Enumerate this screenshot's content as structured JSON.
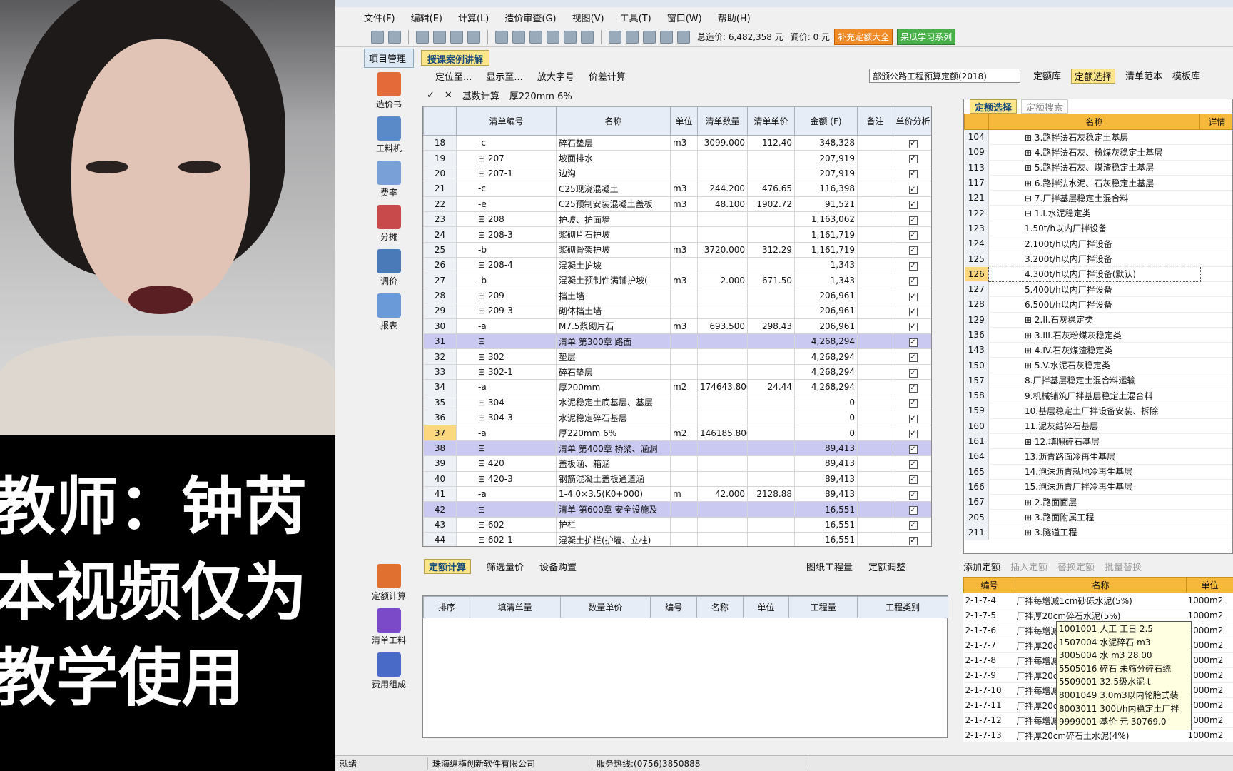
{
  "caption": [
    "教师：钟芮",
    "本视频仅为",
    "教学使用"
  ],
  "menu": [
    "文件(F)",
    "编辑(E)",
    "计算(L)",
    "造价审查(G)",
    "视图(V)",
    "工具(T)",
    "窗口(W)",
    "帮助(H)"
  ],
  "toolbar": {
    "total": "总造价: 6,482,358 元",
    "adjust": "调价: 0 元",
    "btn1": "补充定额大全",
    "btn2": "呆瓜学习系列"
  },
  "leftnav": {
    "tab": "项目管理",
    "items": [
      "造价书",
      "工料机",
      "费率",
      "分摊",
      "调价",
      "报表"
    ],
    "bottom": [
      "定额计算",
      "清单工料",
      "费用组成"
    ]
  },
  "doctab": "授课案例讲解",
  "subbar": [
    "定位至...",
    "显示至...",
    "放大字号",
    "价差计算"
  ],
  "quota": "部颁公路工程预算定额(2018)",
  "rightbtns": [
    "定额库",
    "定额选择",
    "清单范本",
    "模板库"
  ],
  "formula": {
    "label": "基数计算",
    "value": "厚220mm 6%"
  },
  "grid": {
    "headers": [
      "清单编号",
      "名称",
      "单位",
      "清单数量",
      "清单单价",
      "金额 (F)",
      "备注",
      "单价分析"
    ],
    "rows": [
      [
        "18",
        "-c",
        "碎石垫层",
        "m3",
        "3099.000",
        "112.40",
        "348,328",
        ""
      ],
      [
        "19",
        "⊟ 207",
        "坡面排水",
        "",
        "",
        "",
        "207,919",
        ""
      ],
      [
        "20",
        "⊟ 207-1",
        "边沟",
        "",
        "",
        "",
        "207,919",
        ""
      ],
      [
        "21",
        "-c",
        "C25现浇混凝土",
        "m3",
        "244.200",
        "476.65",
        "116,398",
        ""
      ],
      [
        "22",
        "-e",
        "C25预制安装混凝土盖板",
        "m3",
        "48.100",
        "1902.72",
        "91,521",
        ""
      ],
      [
        "23",
        "⊟ 208",
        "护坡、护面墙",
        "",
        "",
        "",
        "1,163,062",
        ""
      ],
      [
        "24",
        "⊟ 208-3",
        "浆砌片石护坡",
        "",
        "",
        "",
        "1,161,719",
        ""
      ],
      [
        "25",
        "-b",
        "浆砌骨架护坡",
        "m3",
        "3720.000",
        "312.29",
        "1,161,719",
        ""
      ],
      [
        "26",
        "⊟ 208-4",
        "混凝土护坡",
        "",
        "",
        "",
        "1,343",
        ""
      ],
      [
        "27",
        "-b",
        "混凝土预制件满铺护坡(",
        "m3",
        "2.000",
        "671.50",
        "1,343",
        ""
      ],
      [
        "28",
        "⊟ 209",
        "挡土墙",
        "",
        "",
        "",
        "206,961",
        ""
      ],
      [
        "29",
        "⊟ 209-3",
        "砌体挡土墙",
        "",
        "",
        "",
        "206,961",
        ""
      ],
      [
        "30",
        "-a",
        "M7.5浆砌片石",
        "m3",
        "693.500",
        "298.43",
        "206,961",
        ""
      ],
      [
        "31",
        "⊟",
        "清单 第300章 路面",
        "",
        "",
        "",
        "4,268,294",
        "sec"
      ],
      [
        "32",
        "⊟ 302",
        "垫层",
        "",
        "",
        "",
        "4,268,294",
        ""
      ],
      [
        "33",
        "⊟ 302-1",
        "碎石垫层",
        "",
        "",
        "",
        "4,268,294",
        ""
      ],
      [
        "34",
        "-a",
        "厚200mm",
        "m2",
        "174643.800",
        "24.44",
        "4,268,294",
        ""
      ],
      [
        "35",
        "⊟ 304",
        "水泥稳定土底基层、基层",
        "",
        "",
        "",
        "0",
        ""
      ],
      [
        "36",
        "⊟ 304-3",
        "水泥稳定碎石基层",
        "",
        "",
        "",
        "0",
        ""
      ],
      [
        "37",
        "-a",
        "厚220mm 6%",
        "m2",
        "146185.800",
        "",
        "0",
        "cur"
      ],
      [
        "38",
        "⊟",
        "清单 第400章 桥梁、涵洞",
        "",
        "",
        "",
        "89,413",
        "sec"
      ],
      [
        "39",
        "⊟ 420",
        "盖板涵、箱涵",
        "",
        "",
        "",
        "89,413",
        ""
      ],
      [
        "40",
        "⊟ 420-3",
        "钢筋混凝土盖板通道涵",
        "",
        "",
        "",
        "89,413",
        ""
      ],
      [
        "41",
        "-a",
        "1-4.0×3.5(K0+000)",
        "m",
        "42.000",
        "2128.88",
        "89,413",
        ""
      ],
      [
        "42",
        "⊟",
        "清单 第600章 安全设施及",
        "",
        "",
        "",
        "16,551",
        "sec"
      ],
      [
        "43",
        "⊟ 602",
        "护栏",
        "",
        "",
        "",
        "16,551",
        ""
      ],
      [
        "44",
        "⊟ 602-1",
        "混凝土护栏(护墙、立柱)",
        "",
        "",
        "",
        "16,551",
        ""
      ]
    ]
  },
  "rtabs": [
    "定额选择",
    "定额搜索"
  ],
  "rtree": {
    "headers": [
      "名称",
      "详情"
    ],
    "rows": [
      [
        "104",
        "⊞ 3.路拌法石灰稳定土基层",
        ""
      ],
      [
        "109",
        "⊞ 4.路拌法石灰、粉煤灰稳定土基层",
        ""
      ],
      [
        "113",
        "⊞ 5.路拌法石灰、煤渣稳定土基层",
        ""
      ],
      [
        "117",
        "⊞ 6.路拌法水泥、石灰稳定土基层",
        ""
      ],
      [
        "121",
        "⊟ 7.厂拌基层稳定土混合料",
        ""
      ],
      [
        "122",
        "⊟ 1.I.水泥稳定类",
        ""
      ],
      [
        "123",
        "1.50t/h以内厂拌设备",
        ""
      ],
      [
        "124",
        "2.100t/h以内厂拌设备",
        ""
      ],
      [
        "125",
        "3.200t/h以内厂拌设备",
        ""
      ],
      [
        "126",
        "4.300t/h以内厂拌设备(默认)",
        "cur"
      ],
      [
        "127",
        "5.400t/h以内厂拌设备",
        ""
      ],
      [
        "128",
        "6.500t/h以内厂拌设备",
        ""
      ],
      [
        "129",
        "⊞ 2.II.石灰稳定类",
        ""
      ],
      [
        "136",
        "⊞ 3.III.石灰粉煤灰稳定类",
        ""
      ],
      [
        "143",
        "⊞ 4.IV.石灰煤渣稳定类",
        ""
      ],
      [
        "150",
        "⊞ 5.V.水泥石灰稳定类",
        ""
      ],
      [
        "157",
        "8.厂拌基层稳定土混合料运输",
        ""
      ],
      [
        "158",
        "9.机械铺筑厂拌基层稳定土混合料",
        ""
      ],
      [
        "159",
        "10.基层稳定土厂拌设备安装、拆除",
        ""
      ],
      [
        "160",
        "11.泥灰结碎石基层",
        ""
      ],
      [
        "161",
        "⊞ 12.填隙碎石基层",
        ""
      ],
      [
        "164",
        "13.沥青路面冷再生基层",
        ""
      ],
      [
        "165",
        "14.泡沫沥青就地冷再生基层",
        ""
      ],
      [
        "166",
        "15.泡沫沥青厂拌冷再生基层",
        ""
      ],
      [
        "167",
        "⊞ 2.路面面层",
        ""
      ],
      [
        "205",
        "⊞ 3.路面附属工程",
        ""
      ],
      [
        "211",
        "⊞ 3.隧道工程",
        ""
      ]
    ]
  },
  "btabs": [
    "定额计算",
    "筛选量价",
    "设备购置",
    "图纸工程量",
    "定额调整"
  ],
  "bgrid": {
    "headers": [
      "排序",
      "填清单量",
      "数量单价",
      "编号",
      "名称",
      "单位",
      "工程量",
      "工程类别"
    ]
  },
  "bpanel": {
    "tools": [
      "添加定额",
      "插入定额",
      "替换定额",
      "批量替换"
    ],
    "headers": [
      "编号",
      "名称",
      "单位"
    ],
    "rows": [
      [
        "2-1-7-4",
        "厂拌每增减1cm砂砾水泥(5%)",
        "1000m2"
      ],
      [
        "2-1-7-5",
        "厂拌厚20cm碎石水泥(5%)",
        "1000m2"
      ],
      [
        "2-1-7-6",
        "厂拌每增减1cm碎石水泥",
        "1000m2"
      ],
      [
        "2-1-7-7",
        "厂拌厚20cm石屑水泥",
        "1000m2"
      ],
      [
        "2-1-7-8",
        "厂拌每增减1cm石屑水泥",
        "1000m2"
      ],
      [
        "2-1-7-9",
        "厂拌厚20cm石渣水泥",
        "1000m2"
      ],
      [
        "2-1-7-10",
        "厂拌每增减1cm石渣水泥",
        "1000m2"
      ],
      [
        "2-1-7-11",
        "厂拌厚20cm砂砾土水泥",
        "1000m2"
      ],
      [
        "2-1-7-12",
        "厂拌每增减1cm砂砾土水泥",
        "1000m2"
      ],
      [
        "2-1-7-13",
        "厂拌厚20cm碎石土水泥(4%)",
        "1000m2"
      ]
    ]
  },
  "tooltip": [
    "1001001 人工 工日 2.5",
    "1507004 水泥碎石 m3",
    "3005004 水 m3 28.00",
    "5505016 碎石 未筛分碎石统",
    "5509001 32.5级水泥 t",
    "8001049 3.0m3以内轮胎式装",
    "8003011 300t/h内稳定土厂拌",
    "9999001 基价 元 30769.0"
  ],
  "status": [
    "就绪",
    "珠海纵横创新软件有限公司",
    "服务热线:(0756)3850888"
  ]
}
